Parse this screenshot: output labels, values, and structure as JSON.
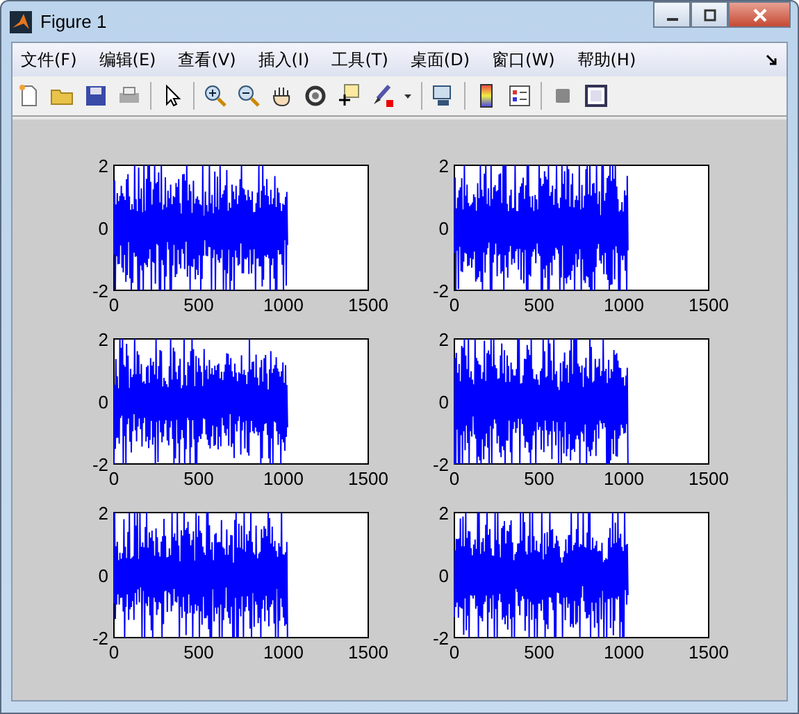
{
  "window": {
    "title": "Figure 1"
  },
  "menu": [
    "文件(F)",
    "编辑(E)",
    "查看(V)",
    "插入(I)",
    "工具(T)",
    "桌面(D)",
    "窗口(W)",
    "帮助(H)"
  ],
  "plots": [
    {
      "kind": "noise",
      "yticks": [
        "2",
        "0",
        "-2"
      ],
      "xticks": [
        "0",
        "500",
        "1000",
        "1500"
      ]
    },
    {
      "kind": "modulated",
      "yticks": [
        "2",
        "0",
        "-2"
      ],
      "xticks": [
        "0",
        "500",
        "1000",
        "1500"
      ]
    },
    {
      "kind": "noise",
      "yticks": [
        "2",
        "0",
        "-2"
      ],
      "xticks": [
        "0",
        "500",
        "1000",
        "1500"
      ]
    },
    {
      "kind": "modulated",
      "yticks": [
        "2",
        "0",
        "-2"
      ],
      "xticks": [
        "0",
        "500",
        "1000",
        "1500"
      ]
    },
    {
      "kind": "noise",
      "yticks": [
        "2",
        "0",
        "-2"
      ],
      "xticks": [
        "0",
        "500",
        "1000",
        "1500"
      ]
    },
    {
      "kind": "modulated",
      "yticks": [
        "2",
        "0",
        "-2"
      ],
      "xticks": [
        "0",
        "500",
        "1000",
        "1500"
      ]
    }
  ]
}
